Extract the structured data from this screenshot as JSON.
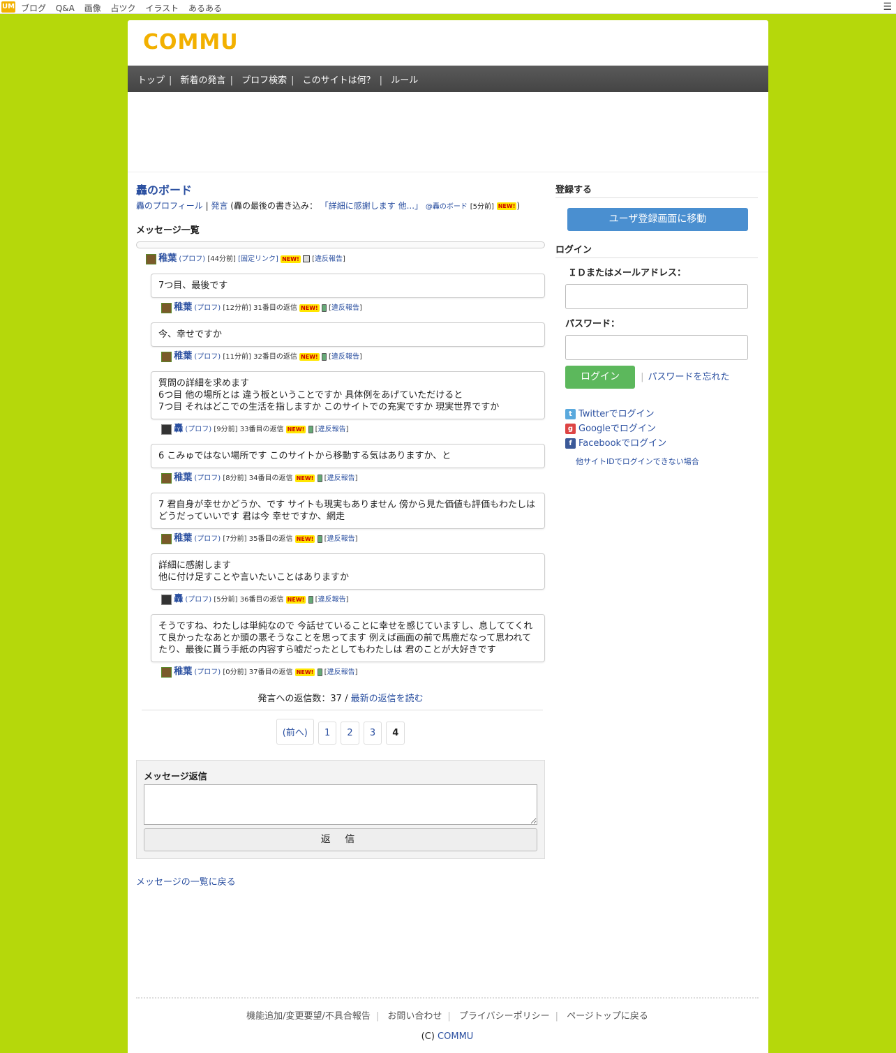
{
  "topbar": {
    "logo": "UM",
    "links": [
      "ブログ",
      "Q&A",
      "画像",
      "占ツク",
      "イラスト",
      "あるある"
    ],
    "menu_icon": "hamburger-icon"
  },
  "site": {
    "brand": "COMMU",
    "nav": [
      "トップ",
      "新着の発言",
      "プロフ検索",
      "このサイトは何？",
      "ルール"
    ]
  },
  "board": {
    "title": "轟のボード",
    "profile_link": "轟のプロフィール",
    "post_link": "発言",
    "last_post_label": "(轟の最後の書き込み：",
    "last_post_text": "「詳細に感謝します 他...」",
    "last_post_board": "@轟のボード",
    "last_post_time": "[5分前]",
    "new_label": "NEW!",
    "list_title": "メッセージ一覧"
  },
  "thread": {
    "author": "稚葉",
    "prof": "(プロフ)",
    "time": "[44分前]",
    "fixed_link": "[固定リンク]",
    "report": "違反報告"
  },
  "replies": [
    {
      "text": "7つ目、最後です",
      "author": "稚葉",
      "time": "[12分前]",
      "num": "31番目の返信"
    },
    {
      "text": "今、幸せですか",
      "author": "稚葉",
      "time": "[11分前]",
      "num": "32番目の返信"
    },
    {
      "text": "質問の詳細を求めます\n6つ目 他の場所とは 違う板ということですか 具体例をあげていただけると\n7つ目 それはどこでの生活を指しますか このサイトでの充実ですか 現実世界ですか",
      "author": "轟",
      "time": "[9分前]",
      "num": "33番目の返信"
    },
    {
      "text": "6 こみゅではない場所です このサイトから移動する気はありますか、と",
      "author": "稚葉",
      "time": "[8分前]",
      "num": "34番目の返信"
    },
    {
      "text": "7 君自身が幸せかどうか、です サイトも現実もありません 傍から見た価値も評価もわたしはどうだっていいです 君は今 幸せですか、網走",
      "author": "稚葉",
      "time": "[7分前]",
      "num": "35番目の返信"
    },
    {
      "text": "詳細に感謝します\n他に付け足すことや言いたいことはありますか",
      "author": "轟",
      "time": "[5分前]",
      "num": "36番目の返信"
    },
    {
      "text": "そうですね、わたしは単純なので 今話せていることに幸せを感じていますし、息しててくれて良かったなあとか頭の悪そうなことを思ってます 例えば画面の前で馬鹿だなって思われてたり、最後に貰う手紙の内容すら嘘だったとしてもわたしは 君のことが大好きです",
      "author": "稚葉",
      "time": "[0分前]",
      "num": "37番目の返信"
    }
  ],
  "summary": {
    "count_label": "発言への返信数：37 /",
    "latest_link": "最新の返信を読む"
  },
  "pager": {
    "prev": "(前へ)",
    "pages": [
      "1",
      "2",
      "3"
    ],
    "current": "4"
  },
  "reply_form": {
    "label": "メッセージ返信",
    "submit": "返 信"
  },
  "back_link": "メッセージの一覧に戻る",
  "sidebar": {
    "register_title": "登録する",
    "register_button": "ユーザ登録画面に移動",
    "login_title": "ログイン",
    "id_label": "ＩＤまたはメールアドレス：",
    "password_label": "パスワード：",
    "login_button": "ログイン",
    "forgot_link": "パスワードを忘れた",
    "twitter": "Twitterでログイン",
    "google": "Googleでログイン",
    "facebook": "Facebookでログイン",
    "other_link": "他サイトIDでログインできない場合"
  },
  "footer": {
    "links": [
      "機能追加/変更要望/不具合報告",
      "お問い合わせ",
      "プライバシーポリシー",
      "ページトップに戻る"
    ],
    "copy_prefix": "(C)",
    "copy_link": "COMMU"
  },
  "colors": {
    "background": "#b5d80b",
    "brand": "#f2b000",
    "link": "#2a4fa0",
    "register_button": "#4a8fd0",
    "login_button": "#5cb85c"
  }
}
